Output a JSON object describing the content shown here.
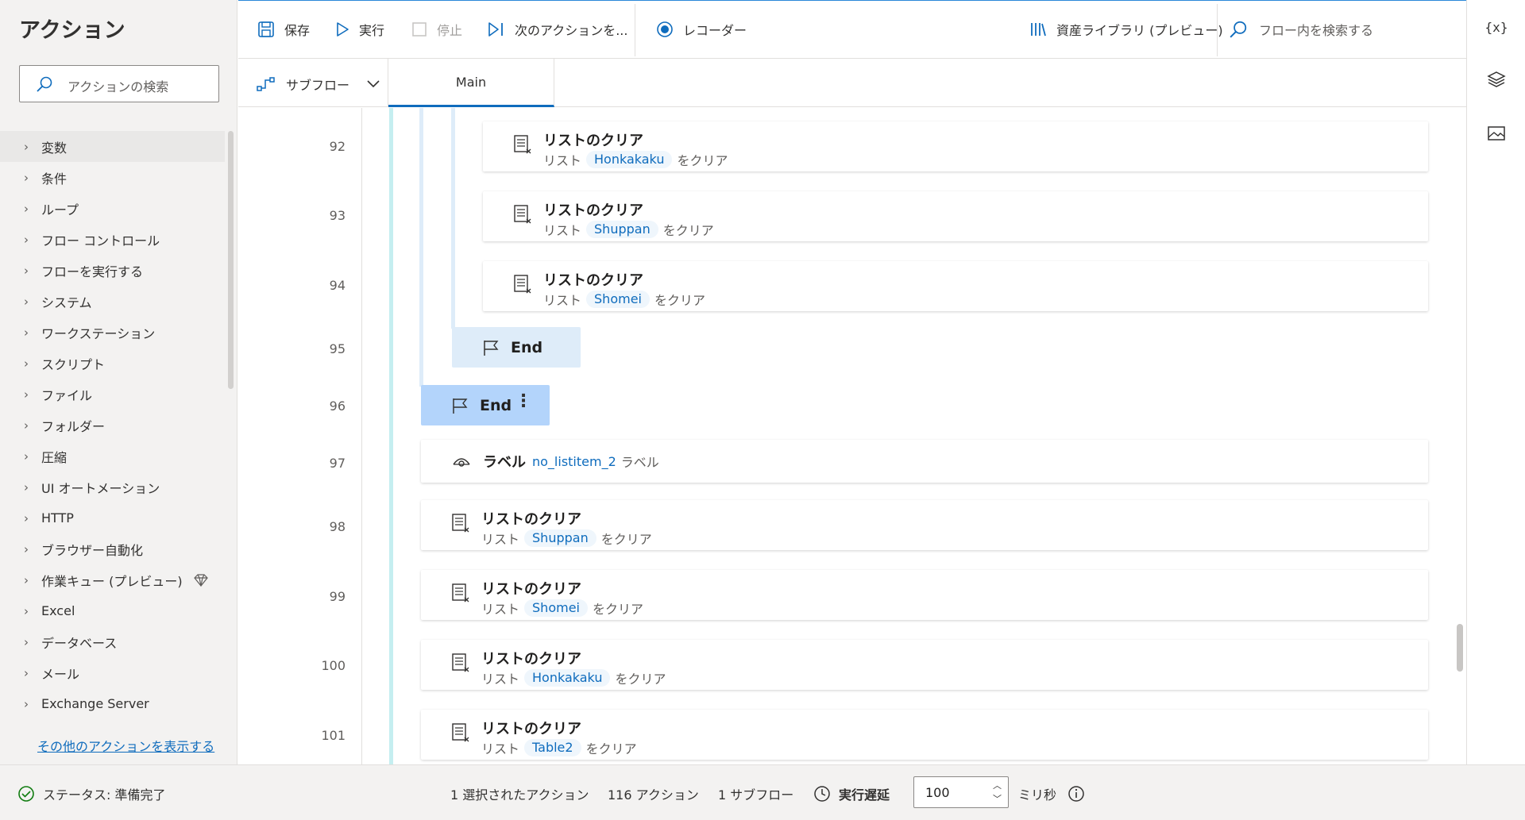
{
  "left_panel": {
    "title": "アクション",
    "search_placeholder": "アクションの検索",
    "categories": [
      {
        "label": "変数",
        "selected": true
      },
      {
        "label": "条件"
      },
      {
        "label": "ループ"
      },
      {
        "label": "フロー コントロール"
      },
      {
        "label": "フローを実行する"
      },
      {
        "label": "システム"
      },
      {
        "label": "ワークステーション"
      },
      {
        "label": "スクリプト"
      },
      {
        "label": "ファイル"
      },
      {
        "label": "フォルダー"
      },
      {
        "label": "圧縮"
      },
      {
        "label": "UI オートメーション"
      },
      {
        "label": "HTTP"
      },
      {
        "label": "ブラウザー自動化"
      },
      {
        "label": "作業キュー (プレビュー)",
        "icon": "premium-diamond-icon"
      },
      {
        "label": "Excel"
      },
      {
        "label": "データベース"
      },
      {
        "label": "メール"
      },
      {
        "label": "Exchange Server"
      }
    ],
    "more_actions_link": "その他のアクションを表示する"
  },
  "toolbar": {
    "save": "保存",
    "run": "実行",
    "stop": "停止",
    "next_action": "次のアクションを...",
    "recorder": "レコーダー",
    "asset_library": "資産ライブラリ (プレビュー)",
    "flow_search_placeholder": "フロー内を検索する"
  },
  "tabs": {
    "subflow": "サブフロー",
    "main": "Main"
  },
  "editor": {
    "line_numbers": [
      "92",
      "93",
      "94",
      "95",
      "96",
      "97",
      "98",
      "99",
      "100",
      "101"
    ],
    "inner_actions": [
      {
        "title": "リストのクリア",
        "prefix": "リスト",
        "var": "Honkakaku",
        "suffix": "をクリア"
      },
      {
        "title": "リストのクリア",
        "prefix": "リスト",
        "var": "Shuppan",
        "suffix": "をクリア"
      },
      {
        "title": "リストのクリア",
        "prefix": "リスト",
        "var": "Shomei",
        "suffix": "をクリア"
      }
    ],
    "end_inner": "End",
    "end_outer": "End",
    "label_action": {
      "title": "ラベル",
      "name": "no_listitem_2",
      "suffix": "ラベル"
    },
    "outer_actions": [
      {
        "title": "リストのクリア",
        "prefix": "リスト",
        "var": "Shuppan",
        "suffix": "をクリア"
      },
      {
        "title": "リストのクリア",
        "prefix": "リスト",
        "var": "Shomei",
        "suffix": "をクリア"
      },
      {
        "title": "リストのクリア",
        "prefix": "リスト",
        "var": "Honkakaku",
        "suffix": "をクリア"
      },
      {
        "title": "リストのクリア",
        "prefix": "リスト",
        "var": "Table2",
        "suffix": "をクリア"
      }
    ]
  },
  "status_bar": {
    "status": "ステータス: 準備完了",
    "selected": "1 選択されたアクション",
    "actions": "116 アクション",
    "subflows": "1 サブフロー",
    "run_delay_label": "実行遅延",
    "run_delay_value": "100",
    "unit": "ミリ秒"
  },
  "colors": {
    "accent": "#0f6cbd",
    "selected_end_bg": "#b3d4fb",
    "end_bg": "#deecf9",
    "loop_line": "#c7e0f4",
    "outer_line": "#c5eef0",
    "status_ok": "#107c10"
  }
}
